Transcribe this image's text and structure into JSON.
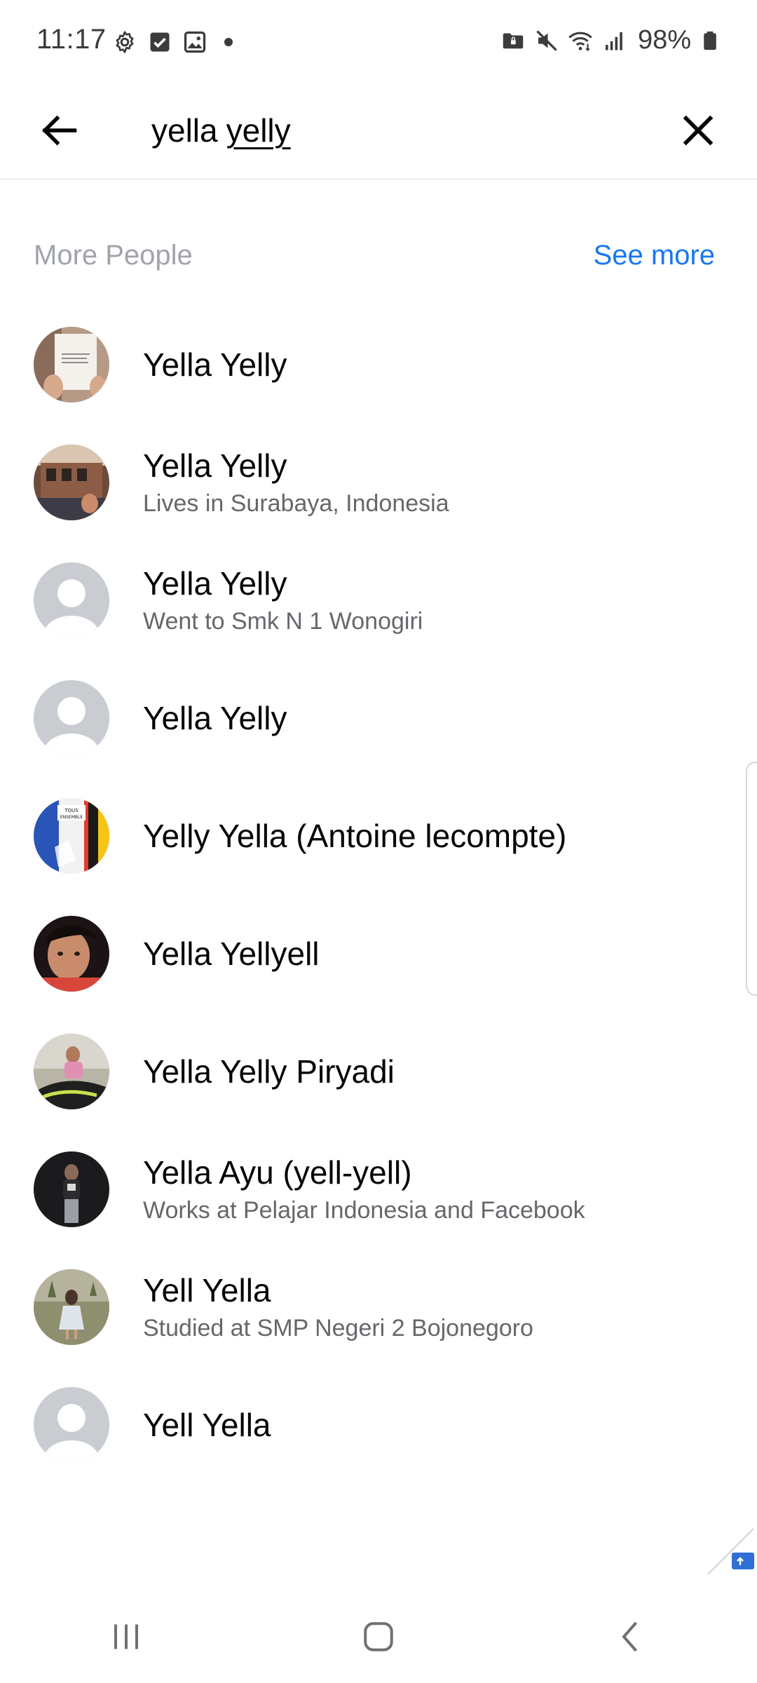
{
  "status_bar": {
    "time": "11:17",
    "battery": "98%"
  },
  "search": {
    "query_word1": "yella",
    "query_word2": "yelly"
  },
  "section": {
    "title": "More People",
    "see_more": "See more"
  },
  "people": [
    {
      "name": "Yella Yelly",
      "subtitle": "",
      "avatar": "photo-book"
    },
    {
      "name": "Yella Yelly",
      "subtitle": "Lives in Surabaya, Indonesia",
      "avatar": "photo-building"
    },
    {
      "name": "Yella Yelly",
      "subtitle": "Went to Smk N 1 Wonogiri",
      "avatar": "default-silhouette"
    },
    {
      "name": "Yella Yelly",
      "subtitle": "",
      "avatar": "default-silhouette"
    },
    {
      "name": "Yelly Yella (Antoine lecompte)",
      "subtitle": "",
      "avatar": "photo-flag-tous-ensemble"
    },
    {
      "name": "Yella Yellyell",
      "subtitle": "",
      "avatar": "photo-selfie"
    },
    {
      "name": "Yella Yelly Piryadi",
      "subtitle": "",
      "avatar": "photo-girl-motorbike"
    },
    {
      "name": "Yella Ayu (yell-yell)",
      "subtitle": "Works at Pelajar Indonesia and Facebook",
      "avatar": "photo-dark-portrait"
    },
    {
      "name": "Yell Yella",
      "subtitle": "Studied at SMP Negeri 2 Bojonegoro",
      "avatar": "photo-girl-field"
    },
    {
      "name": "Yell Yella",
      "subtitle": "",
      "avatar": "default-silhouette"
    }
  ],
  "colors": {
    "accent": "#1877f2",
    "section_title": "#a0a4aa",
    "subtitle": "#65676b",
    "name": "#050505"
  }
}
